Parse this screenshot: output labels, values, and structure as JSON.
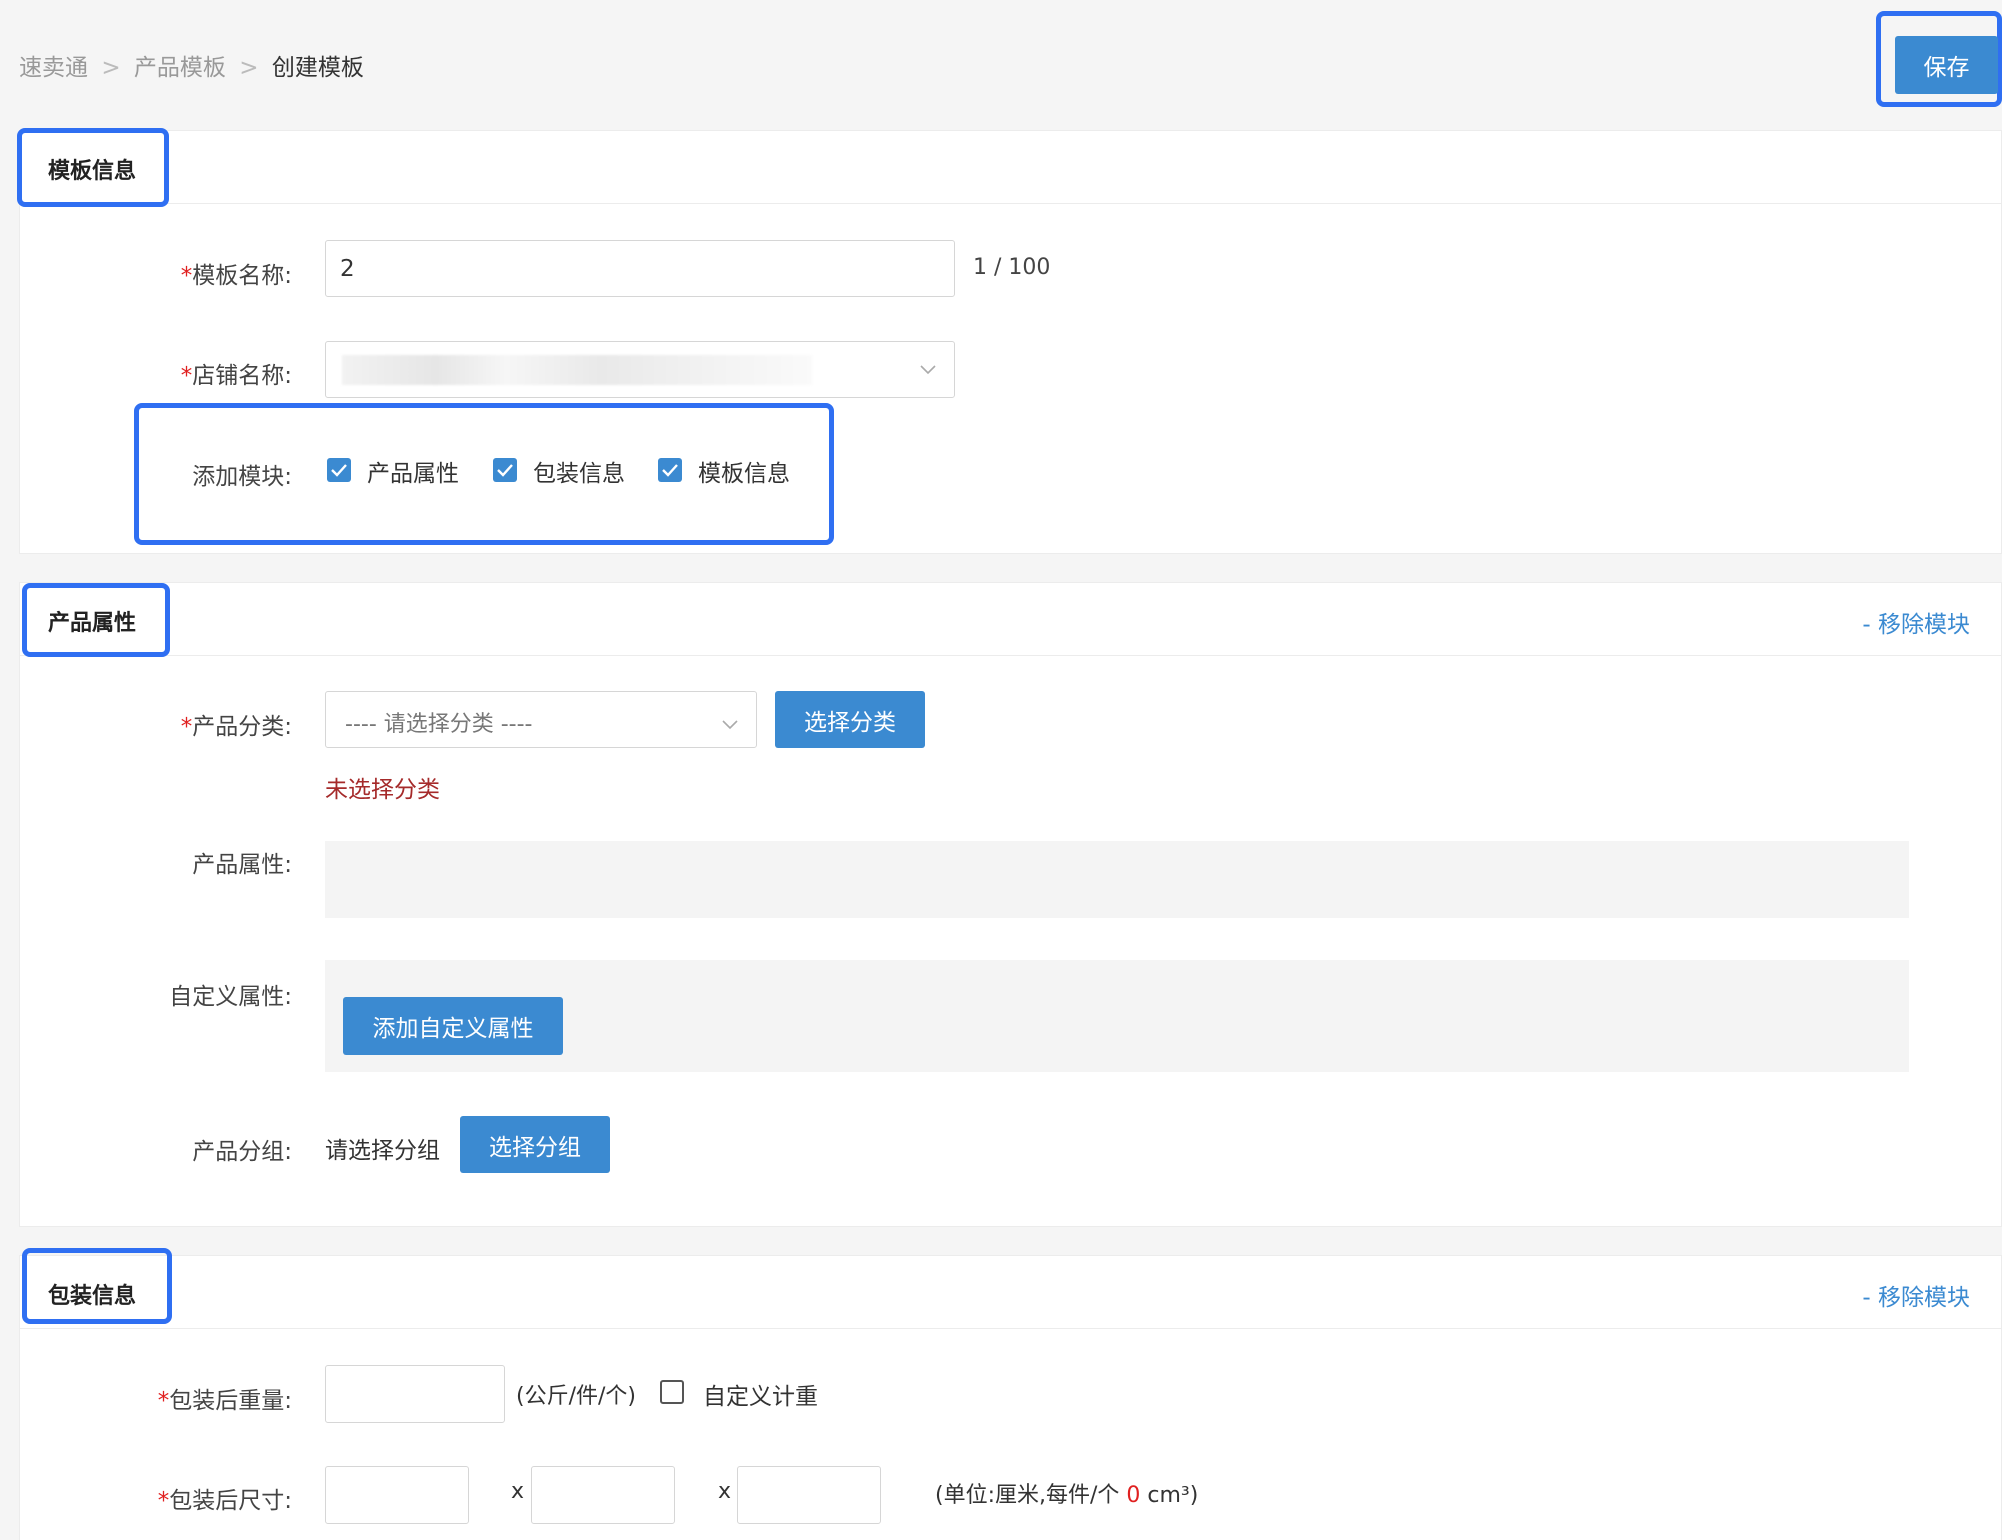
{
  "breadcrumb": {
    "items": [
      "速卖通",
      "产品模板",
      "创建模板"
    ],
    "separator": ">"
  },
  "toolbar": {
    "save_label": "保存"
  },
  "template_info": {
    "title": "模板信息",
    "name_label": "模板名称:",
    "name_value": "2",
    "name_counter": "1 / 100",
    "store_label": "店铺名称:",
    "modules_label": "添加模块:",
    "modules": [
      {
        "label": "产品属性",
        "checked": true
      },
      {
        "label": "包装信息",
        "checked": true
      },
      {
        "label": "模板信息",
        "checked": true
      }
    ]
  },
  "product_attrs": {
    "title": "产品属性",
    "remove_label": "- 移除模块",
    "category_label": "产品分类:",
    "category_placeholder": "---- 请选择分类 ----",
    "select_category_btn": "选择分类",
    "category_error": "未选择分类",
    "attrs_label": "产品属性:",
    "custom_attrs_label": "自定义属性:",
    "add_custom_attr_btn": "添加自定义属性",
    "group_label": "产品分组:",
    "group_placeholder": "请选择分组",
    "select_group_btn": "选择分组"
  },
  "package_info": {
    "title": "包装信息",
    "remove_label": "- 移除模块",
    "weight_label": "包装后重量:",
    "weight_unit": "(公斤/件/个)",
    "custom_weight_label": "自定义计重",
    "size_label": "包装后尺寸:",
    "size_sep": "x",
    "size_unit_prefix": "(单位:厘米,每件/个",
    "size_volume": "0",
    "size_unit_suffix": "cm³)"
  },
  "colors": {
    "accent": "#3b8ad1",
    "highlight": "#2f6ff2",
    "error": "#a52a2a",
    "required": "#e02020"
  }
}
